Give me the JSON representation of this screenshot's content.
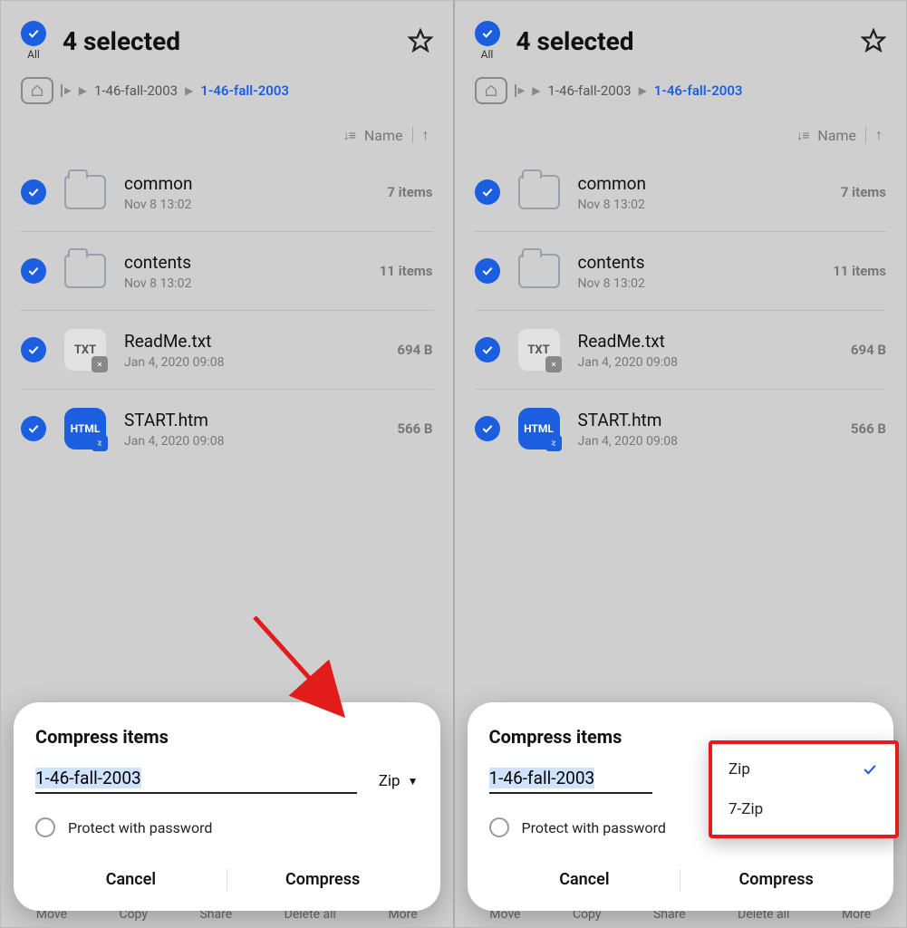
{
  "header": {
    "all_label": "All",
    "title": "4 selected"
  },
  "breadcrumb": {
    "middle": "1-46-fall-2003",
    "current": "1-46-fall-2003"
  },
  "sort": {
    "label": "Name"
  },
  "files": [
    {
      "name": "common",
      "date": "Nov 8 13:02",
      "meta": "7 items",
      "kind": "folder"
    },
    {
      "name": "contents",
      "date": "Nov 8 13:02",
      "meta": "11 items",
      "kind": "folder"
    },
    {
      "name": "ReadMe.txt",
      "date": "Jan 4, 2020 09:08",
      "meta": "694 B",
      "kind": "txt"
    },
    {
      "name": "START.htm",
      "date": "Jan 4, 2020 09:08",
      "meta": "566 B",
      "kind": "html"
    }
  ],
  "sheet": {
    "title": "Compress items",
    "filename": "1-46-fall-2003",
    "format": "Zip",
    "protect_label": "Protect with password",
    "cancel": "Cancel",
    "confirm": "Compress",
    "options": [
      "Zip",
      "7-Zip"
    ]
  },
  "bottombar": [
    "Move",
    "Copy",
    "Share",
    "Delete all",
    "More"
  ],
  "icons": {
    "txt_label": "TXT",
    "html_label": "HTML"
  }
}
